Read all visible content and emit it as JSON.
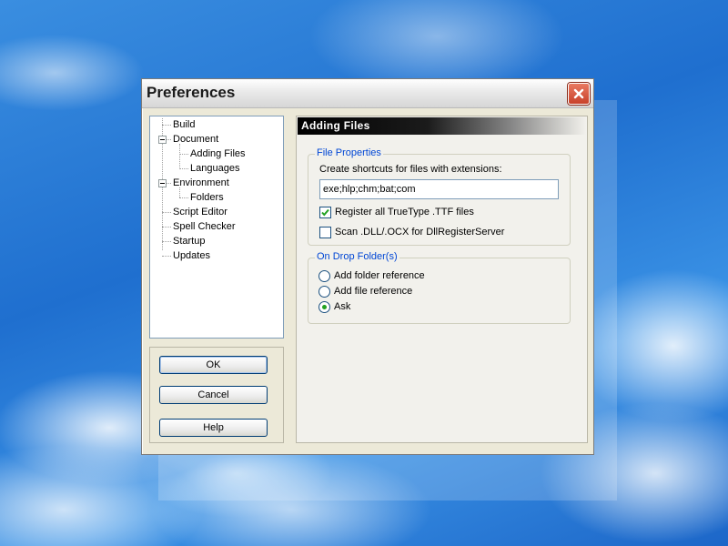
{
  "window": {
    "title": "Preferences"
  },
  "tree": {
    "items": [
      {
        "label": "Build"
      },
      {
        "label": "Document"
      },
      {
        "label": "Adding Files"
      },
      {
        "label": "Languages"
      },
      {
        "label": "Environment"
      },
      {
        "label": "Folders"
      },
      {
        "label": "Script Editor"
      },
      {
        "label": "Spell Checker"
      },
      {
        "label": "Startup"
      },
      {
        "label": "Updates"
      }
    ]
  },
  "buttons": {
    "ok": "OK",
    "cancel": "Cancel",
    "help": "Help"
  },
  "panel": {
    "header": "Adding Files"
  },
  "file_properties": {
    "title": "File Properties",
    "shortcut_label": "Create shortcuts for files with extensions:",
    "extensions_value": "exe;hlp;chm;bat;com",
    "register_ttf": {
      "label": "Register all TrueType .TTF files",
      "checked": true
    },
    "scan_dll": {
      "label": "Scan .DLL/.OCX for DllRegisterServer",
      "checked": false
    }
  },
  "drop_folder": {
    "title": "On Drop Folder(s)",
    "options": [
      {
        "label": "Add folder reference",
        "selected": false
      },
      {
        "label": "Add file reference",
        "selected": false
      },
      {
        "label": "Ask",
        "selected": true
      }
    ]
  },
  "icons": {
    "close": "close-icon",
    "checkmark": "checkmark-icon",
    "expander": "minus-expander-icon"
  },
  "colors": {
    "group_title": "#0046d5",
    "close_button": "#c8412a",
    "radio_selected": "#21a121",
    "checkmark": "#21a121"
  }
}
